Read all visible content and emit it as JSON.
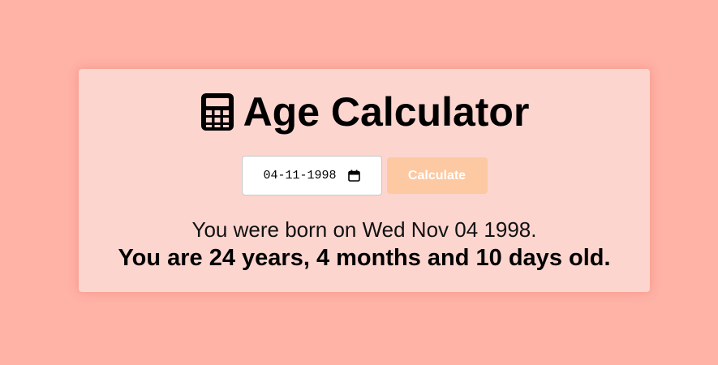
{
  "app": {
    "title": "Age Calculator",
    "title_icon": "calculator-icon"
  },
  "form": {
    "date_value": "04-11-1998",
    "date_icon": "calendar-icon",
    "button_label": "Calculate"
  },
  "result": {
    "born_text": "You were born on Wed Nov 04 1998.",
    "age_text": "You are 24 years, 4 months and 10 days old."
  },
  "colors": {
    "background": "#ffb2a6",
    "card": "#fdd5cf",
    "button": "#fdc9a2"
  }
}
